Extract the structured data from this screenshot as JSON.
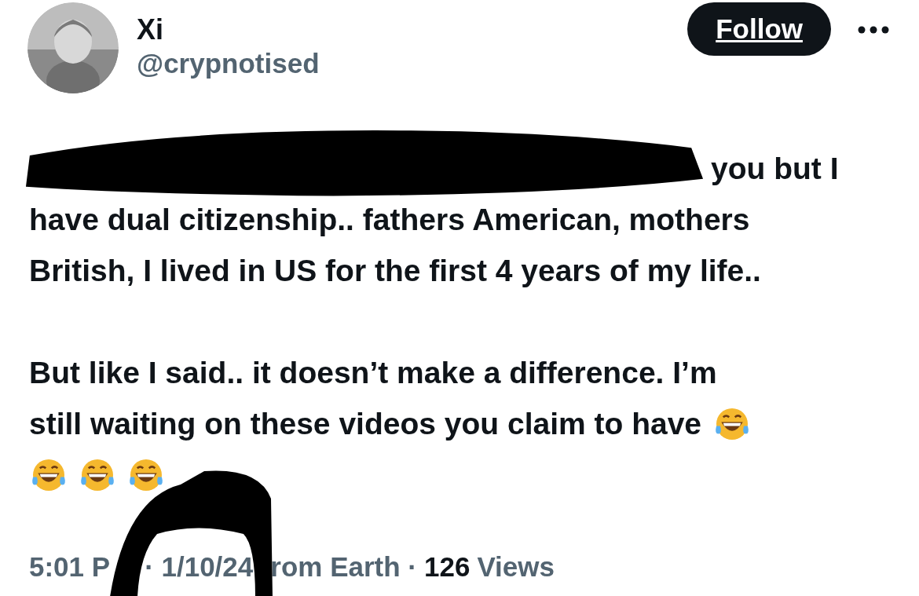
{
  "author": {
    "name": "Xi",
    "handle": "@crypnotised"
  },
  "follow_button": {
    "label": "Follow"
  },
  "body": {
    "first_paragraph_lines": [
      "you but I",
      "have dual citizenship.. fathers American, mothers",
      "British, I lived in US for the first 4 years of my life.."
    ],
    "second_paragraph_lines": [
      "But like I said.. it doesn’t make a difference. I’m",
      "still waiting on these videos you claim to have"
    ]
  },
  "meta": {
    "time": "5:01 P",
    "date": "· 1/10/24",
    "location": "rom Earth ·",
    "views_count": "126",
    "views_label": "Views"
  }
}
